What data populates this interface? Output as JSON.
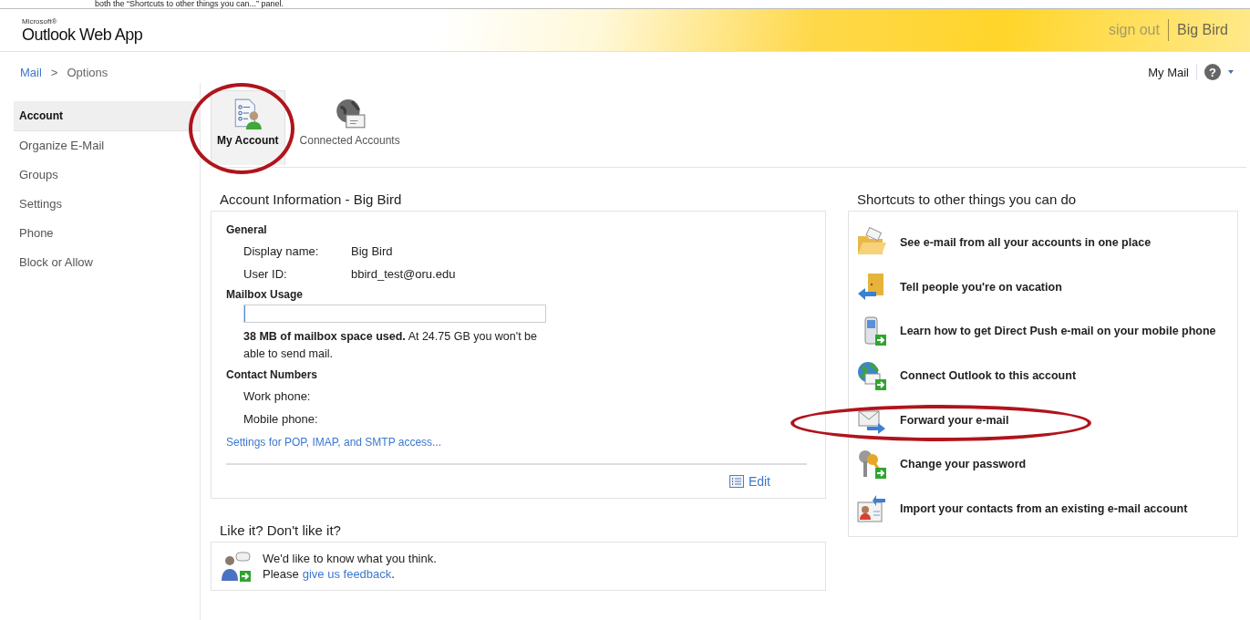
{
  "caption": "both the “Shortcuts to other things you can...” panel.",
  "header": {
    "brand_small": "Microsoft®",
    "brand": "Outlook Web App",
    "sign_out": "sign out",
    "user": "Big Bird"
  },
  "breadcrumb": {
    "items": [
      "Mail",
      "Options"
    ],
    "separator": ">"
  },
  "top_right": {
    "my_mail": "My Mail",
    "help_icon": "?"
  },
  "sidebar": {
    "items": [
      {
        "label": "Account",
        "selected": true
      },
      {
        "label": "Organize E-Mail",
        "selected": false
      },
      {
        "label": "Groups",
        "selected": false
      },
      {
        "label": "Settings",
        "selected": false
      },
      {
        "label": "Phone",
        "selected": false
      },
      {
        "label": "Block or Allow",
        "selected": false
      }
    ]
  },
  "tabs": [
    {
      "label": "My Account",
      "kind": "account",
      "selected": true,
      "circled": true
    },
    {
      "label": "Connected Accounts",
      "kind": "globe",
      "selected": false,
      "circled": false
    }
  ],
  "account_info": {
    "title": "Account Information - Big Bird",
    "general": {
      "heading": "General",
      "fields": [
        {
          "label": "Display name:",
          "value": "Big Bird"
        },
        {
          "label": "User ID:",
          "value": "bbird_test@oru.edu"
        }
      ]
    },
    "mailbox": {
      "heading": "Mailbox Usage",
      "level": 0.0015,
      "text": "**38 MB of mailbox space used.** At 24.75 GB you won't be able to send mail."
    },
    "contact": {
      "heading": "Contact Numbers",
      "fields": [
        {
          "label": "Work phone:"
        },
        {
          "label": "Mobile phone:"
        }
      ]
    },
    "settings_link": "Settings for POP, IMAP, and SMTP access...",
    "edit": "Edit"
  },
  "shortcuts": {
    "title": "Shortcuts to other things you can do",
    "items": [
      {
        "label": "See e-mail from all your accounts in one place",
        "kind": "folder",
        "circled": false
      },
      {
        "label": "Tell people you're on vacation",
        "kind": "vacation",
        "circled": false
      },
      {
        "label": "Learn how to get Direct Push e-mail on your mobile phone",
        "kind": "phone",
        "circled": false
      },
      {
        "label": "Connect Outlook to this account",
        "kind": "globe",
        "circled": false
      },
      {
        "label": "Forward your e-mail",
        "kind": "forward",
        "circled": true
      },
      {
        "label": "Change your password",
        "kind": "key",
        "circled": false
      },
      {
        "label": "Import your contacts from an existing e-mail account",
        "kind": "contacts",
        "circled": false
      }
    ]
  },
  "feedback": {
    "title": "Like it? Don't like it?",
    "line1": "We'd like to know what you think.",
    "line2_before": "Please",
    "link": "give us feedback",
    "line2_after": "."
  }
}
